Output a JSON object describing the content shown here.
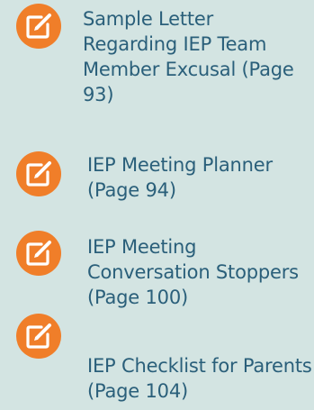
{
  "resources": [
    {
      "label": "Sample Letter Regarding IEP Team Member Excusal (Page 93)",
      "icon": "edit-note-icon"
    },
    {
      "label": "IEP Meeting Planner (Page 94)",
      "icon": "edit-note-icon"
    },
    {
      "label": "IEP Meeting Conversation Stoppers (Page 100)",
      "icon": "edit-note-icon"
    },
    {
      "label": "IEP Checklist for Parents (Page 104)",
      "icon": "edit-note-icon"
    }
  ],
  "colors": {
    "background": "#d3e4e2",
    "icon_circle": "#f07e29",
    "text": "#2a5f7a"
  }
}
